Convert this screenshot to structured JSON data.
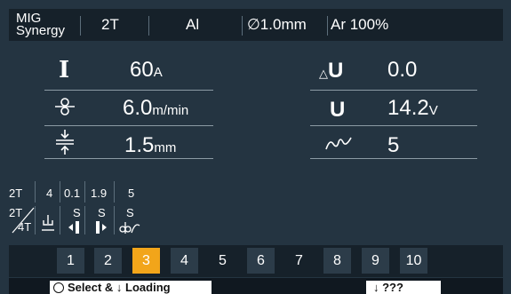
{
  "header": {
    "mode_line1": "MIG",
    "mode_line2": "Synergy",
    "trigger": "2T",
    "material": "Al",
    "wire": "∅1.0mm",
    "gas": "Ar 100%"
  },
  "params": {
    "current_value": "60",
    "current_unit": "A",
    "current_symbol": "I",
    "wire_speed_value": "6.0",
    "wire_speed_unit": "m/min",
    "thickness_value": "1.5",
    "thickness_unit": "mm",
    "voltage_trim_symbol": "U",
    "voltage_trim_value": "0.0",
    "voltage_symbol": "U",
    "voltage_value": "14.2",
    "voltage_unit": "V",
    "inductance_value": "5"
  },
  "sequence": {
    "mode": "2T",
    "values": [
      "4",
      "0.1",
      "1.9",
      "5"
    ],
    "mode_toggle_a": "2T",
    "mode_toggle_b": "4T",
    "s_labels": [
      "S",
      "S",
      "S"
    ]
  },
  "programs": [
    "1",
    "2",
    "3",
    "4",
    "5",
    "6",
    "7",
    "8",
    "9",
    "10"
  ],
  "active_program": "3",
  "footer": {
    "left_label": "Select & ↓ Loading",
    "right_label": "↓ ???"
  },
  "colors": {
    "accent": "#f2a51a",
    "background": "#243441",
    "header": "#16212a"
  }
}
